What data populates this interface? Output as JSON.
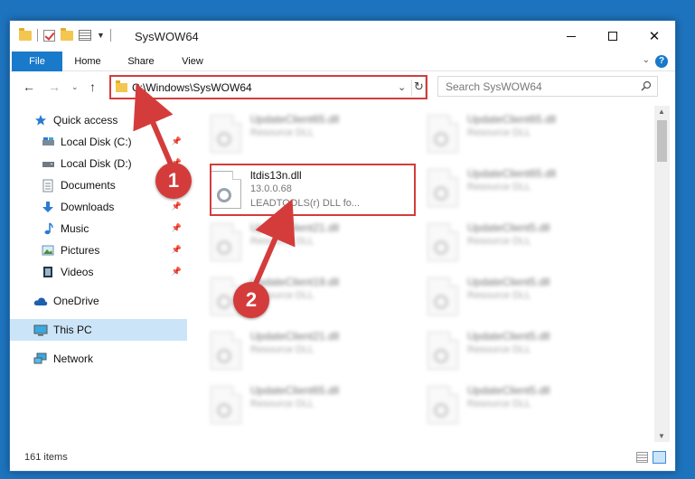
{
  "window": {
    "title": "SysWOW64",
    "controls": {
      "minimize": "minimize",
      "maximize": "maximize",
      "close": "✕"
    }
  },
  "ribbon": {
    "tabs": [
      "File",
      "Home",
      "Share",
      "View"
    ],
    "help": "?"
  },
  "nav": {
    "address": "C:\\Windows\\SysWOW64",
    "search_placeholder": "Search SysWOW64"
  },
  "sidebar": {
    "items": [
      {
        "label": "Quick access",
        "icon": "star-icon",
        "pinned": false
      },
      {
        "label": "Local Disk (C:)",
        "icon": "drive-icon",
        "pinned": true
      },
      {
        "label": "Local Disk (D:)",
        "icon": "drive-icon",
        "pinned": true
      },
      {
        "label": "Documents",
        "icon": "documents-icon",
        "pinned": true
      },
      {
        "label": "Downloads",
        "icon": "download-icon",
        "pinned": true
      },
      {
        "label": "Music",
        "icon": "music-icon",
        "pinned": true
      },
      {
        "label": "Pictures",
        "icon": "pictures-icon",
        "pinned": true
      },
      {
        "label": "Videos",
        "icon": "videos-icon",
        "pinned": true
      },
      {
        "label": "OneDrive",
        "icon": "cloud-icon",
        "pinned": false
      },
      {
        "label": "This PC",
        "icon": "computer-icon",
        "pinned": false,
        "selected": true
      },
      {
        "label": "Network",
        "icon": "network-icon",
        "pinned": false
      }
    ]
  },
  "files": {
    "col1": [
      {
        "name": "UpdateClient65.dll",
        "type": "Resource DLL"
      },
      {
        "name": "ltdis13n.dll",
        "version": "13.0.0.68",
        "desc": "LEADTOOLS(r) DLL fo...",
        "featured": true
      },
      {
        "name": "UpdateClient21.dll",
        "type": "Resource DLL"
      },
      {
        "name": "UpdateClient19.dll",
        "type": "Resource DLL"
      },
      {
        "name": "UpdateClient21.dll",
        "type": "Resource DLL"
      },
      {
        "name": "UpdateClient65.dll",
        "type": "Resource DLL"
      }
    ],
    "col2": [
      {
        "name": "UpdateClient65.dll",
        "type": "Resource DLL"
      },
      {
        "name": "UpdateClient65.dll",
        "type": "Resource DLL"
      },
      {
        "name": "UpdateClient5.dll",
        "type": "Resource DLL"
      },
      {
        "name": "UpdateClient5.dll",
        "type": "Resource DLL"
      },
      {
        "name": "UpdateClient5.dll",
        "type": "Resource DLL"
      },
      {
        "name": "UpdateClient5.dll",
        "type": "Resource DLL"
      }
    ]
  },
  "status": {
    "item_count": "161 items"
  },
  "annotations": {
    "step1": "1",
    "step2": "2",
    "color": "#d43c3c"
  }
}
